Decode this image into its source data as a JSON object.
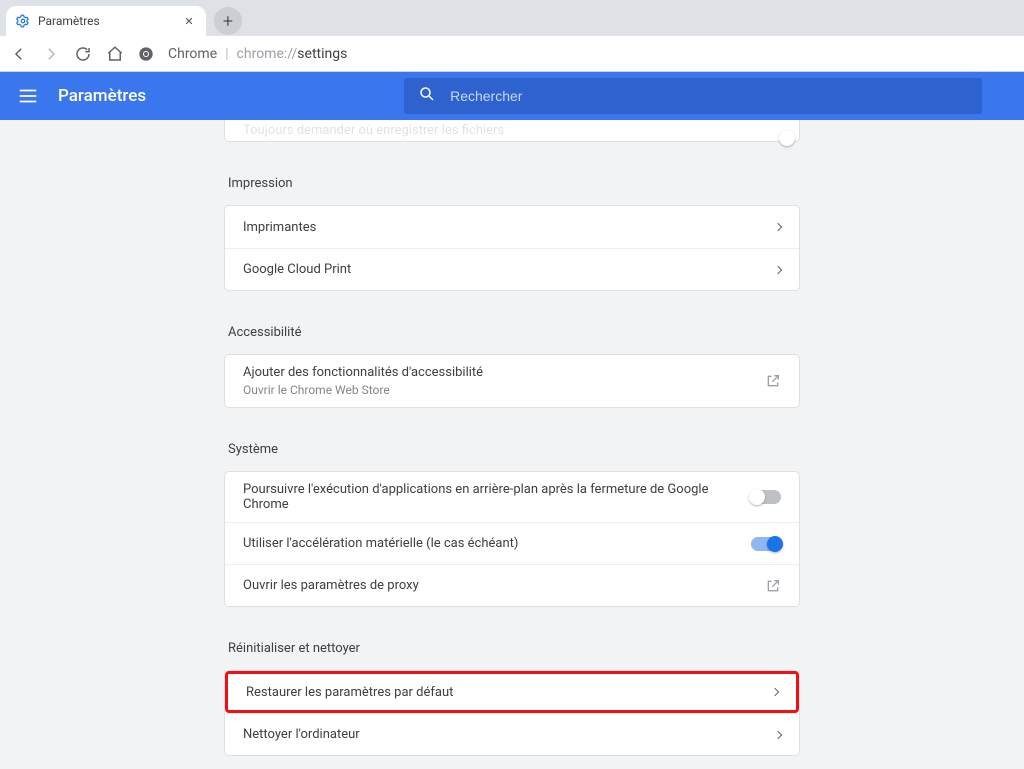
{
  "browser": {
    "tab_title": "Paramètres",
    "omnibox_label": "Chrome",
    "omnibox_url_prefix": "chrome://",
    "omnibox_url_path": "settings"
  },
  "header": {
    "title": "Paramètres",
    "search_placeholder": "Rechercher"
  },
  "truncated_row": {
    "label": "Toujours demander où enregistrer les fichiers"
  },
  "sections": [
    {
      "title": "Impression",
      "rows": [
        {
          "label": "Imprimantes",
          "kind": "link"
        },
        {
          "label": "Google Cloud Print",
          "kind": "link"
        }
      ]
    },
    {
      "title": "Accessibilité",
      "rows": [
        {
          "label": "Ajouter des fonctionnalités d'accessibilité",
          "sub": "Ouvrir le Chrome Web Store",
          "kind": "external"
        }
      ]
    },
    {
      "title": "Système",
      "rows": [
        {
          "label": "Poursuivre l'exécution d'applications en arrière-plan après la fermeture de Google Chrome",
          "kind": "toggle",
          "value": false
        },
        {
          "label": "Utiliser l'accélération matérielle (le cas échéant)",
          "kind": "toggle",
          "value": true
        },
        {
          "label": "Ouvrir les paramètres de proxy",
          "kind": "external"
        }
      ]
    },
    {
      "title": "Réinitialiser et nettoyer",
      "rows": [
        {
          "label": "Restaurer les paramètres par défaut",
          "kind": "link",
          "highlight": true
        },
        {
          "label": "Nettoyer l'ordinateur",
          "kind": "link"
        }
      ]
    }
  ]
}
